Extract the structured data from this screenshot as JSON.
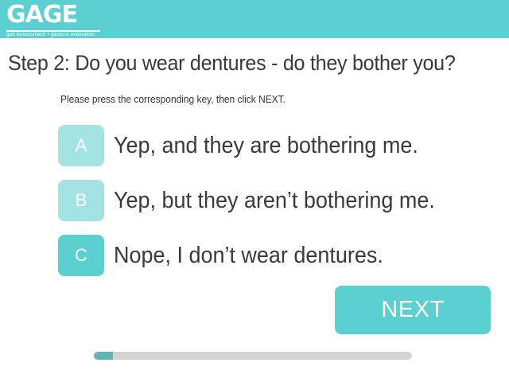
{
  "header": {
    "logo_text": "GAGE",
    "logo_tagline": "gait assessment + gesture evaluation"
  },
  "question": {
    "title": "Step 2: Do you wear dentures - do they bother you?",
    "instruction": "Please press the corresponding key, then click NEXT."
  },
  "options": [
    {
      "key": "A",
      "text": "Yep, and they are bothering me.",
      "selected": false
    },
    {
      "key": "B",
      "text": "Yep, but they aren’t bothering me.",
      "selected": false
    },
    {
      "key": "C",
      "text": "Nope, I don’t wear dentures.",
      "selected": true
    }
  ],
  "next_button": {
    "label": "NEXT"
  },
  "progress": {
    "value": 0.06
  },
  "colors": {
    "accent": "#5ccfd1",
    "accent_light": "#a3e3e4",
    "progress_fill": "#5fb3b5",
    "progress_track": "#d4d4d4",
    "text": "#3a3a3a"
  }
}
